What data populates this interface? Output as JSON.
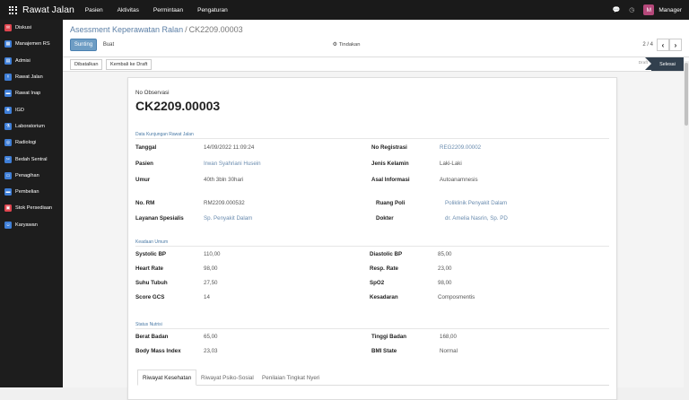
{
  "topbar": {
    "brand": "Rawat Jalan",
    "menu": [
      "Pasien",
      "Aktivitas",
      "Permintaan",
      "Pengaturan"
    ],
    "user_initial": "M",
    "user_name": "Manager"
  },
  "sidebar": {
    "items": [
      {
        "label": "Diskusi",
        "color": "#e0454f",
        "glyph": "✉"
      },
      {
        "label": "Manajemen RS",
        "color": "#3f7fd8",
        "glyph": "▦"
      },
      {
        "label": "Admisi",
        "color": "#3f7fd8",
        "glyph": "▤"
      },
      {
        "label": "Rawat Jalan",
        "color": "#3f7fd8",
        "glyph": "⚕"
      },
      {
        "label": "Rawat Inap",
        "color": "#3f7fd8",
        "glyph": "▬"
      },
      {
        "label": "IGD",
        "color": "#3f7fd8",
        "glyph": "✚"
      },
      {
        "label": "Laboratorium",
        "color": "#3f7fd8",
        "glyph": "⚗"
      },
      {
        "label": "Radiologi",
        "color": "#3f7fd8",
        "glyph": "◎"
      },
      {
        "label": "Bedah Sentral",
        "color": "#3f7fd8",
        "glyph": "✂"
      },
      {
        "label": "Penagihan",
        "color": "#3f7fd8",
        "glyph": "▭"
      },
      {
        "label": "Pembelian",
        "color": "#3f7fd8",
        "glyph": "▬"
      },
      {
        "label": "Stok Persediaan",
        "color": "#e0454f",
        "glyph": "▣"
      },
      {
        "label": "Karyawan",
        "color": "#3f7fd8",
        "glyph": "☺"
      }
    ]
  },
  "controlpanel": {
    "breadcrumb_parent": "Asessment Keperawatan Ralan",
    "breadcrumb_sep": "/",
    "breadcrumb_current": "CK2209.00003",
    "edit_label": "Sunting",
    "create_label": "Buat",
    "action_label": "Tindakan",
    "pager": "2 / 4"
  },
  "statusbar": {
    "cancel_label": "Dibatalkan",
    "back_to_draft_label": "Kembali ke Draft",
    "stage_draft": "Draft",
    "stage_done": "Selesai"
  },
  "form": {
    "obs_label": "No Observasi",
    "obs_number": "CK2209.00003",
    "visit_section": "Data Kunjungan Rawat Jalan",
    "visit": {
      "tanggal_label": "Tanggal",
      "tanggal": "14/09/2022 11:09:24",
      "pasien_label": "Pasien",
      "pasien": "Irwan Syahriani Husein",
      "umur_label": "Umur",
      "umur": "40th 3bln 30hari",
      "noreg_label": "No Registrasi",
      "noreg": "REG2209.00002",
      "jk_label": "Jenis Kelamin",
      "jk": "Laki-Laki",
      "asal_label": "Asal Informasi",
      "asal": "Autoanamnesis",
      "norm_label": "No. RM",
      "norm": "RM2209.000532",
      "layanan_label": "Layanan Spesialis",
      "layanan": "Sp. Penyakit Dalam",
      "ruang_label": "Ruang Poli",
      "ruang": "Poliklinik Penyakit Dalam",
      "dokter_label": "Dokter",
      "dokter": "dr. Amelia Nasrin, Sp. PD"
    },
    "general_section": "Keadaan Umum",
    "general": {
      "systolic_label": "Systolic BP",
      "systolic": "110,00",
      "hr_label": "Heart Rate",
      "hr": "98,00",
      "suhu_label": "Suhu Tubuh",
      "suhu": "27,50",
      "gcs_label": "Score GCS",
      "gcs": "14",
      "diastolic_label": "Diastolic BP",
      "diastolic": "85,00",
      "resp_label": "Resp. Rate",
      "resp": "23,00",
      "spo2_label": "SpO2",
      "spo2": "98,00",
      "kesadaran_label": "Kesadaran",
      "kesadaran": "Composmentis"
    },
    "nutrition_section": "Status Nutrisi",
    "nutrition": {
      "bb_label": "Berat Badan",
      "bb": "65,00",
      "bmi_label": "Body Mass Index",
      "bmi": "23,03",
      "tb_label": "Tinggi Badan",
      "tb": "168,00",
      "bmistate_label": "BMI State",
      "bmistate": "Normal"
    },
    "tabs": [
      "Riwayat Kesehatan",
      "Riwayat Psiko-Sosial",
      "Penilaian Tingkat Nyeri"
    ]
  }
}
